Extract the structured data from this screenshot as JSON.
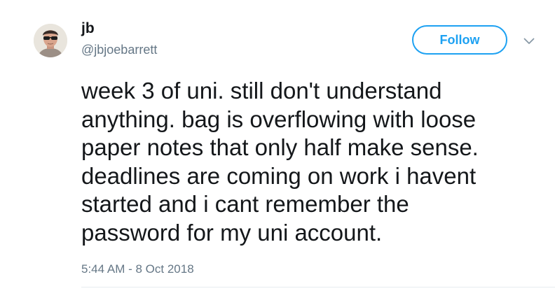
{
  "author": {
    "display_name": "jb",
    "username": "@jbjoebarrett"
  },
  "actions": {
    "follow_label": "Follow",
    "menu_icon": "chevron-down-icon"
  },
  "tweet": {
    "lines": [
      "week 3 of uni. still don't understand",
      "anything. bag is overflowing with loose",
      "paper notes that only half make sense.",
      "deadlines are coming on work i havent",
      "started and i cant remember the",
      "password for my uni account."
    ],
    "timestamp": "5:44 AM - 8 Oct 2018"
  },
  "colors": {
    "accent": "#1da1f2",
    "secondary_text": "#657786",
    "primary_text": "#14171a"
  }
}
